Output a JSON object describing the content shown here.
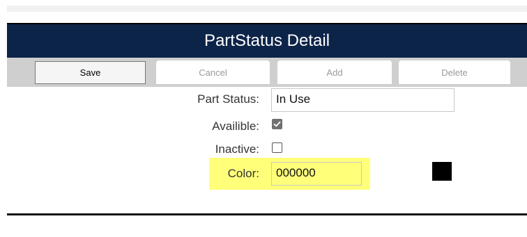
{
  "title": "PartStatus Detail",
  "toolbar": {
    "save_label": "Save",
    "cancel_label": "Cancel",
    "add_label": "Add",
    "delete_label": "Delete"
  },
  "form": {
    "part_status_label": "Part Status:",
    "part_status_value": "In Use",
    "availible_label": "Availible:",
    "availible_checked": true,
    "inactive_label": "Inactive:",
    "inactive_checked": false,
    "color_label": "Color:",
    "color_value": "000000",
    "color_swatch": "#000000"
  },
  "colors": {
    "title_bar": "#0d2449",
    "highlight": "#ffff7a"
  }
}
